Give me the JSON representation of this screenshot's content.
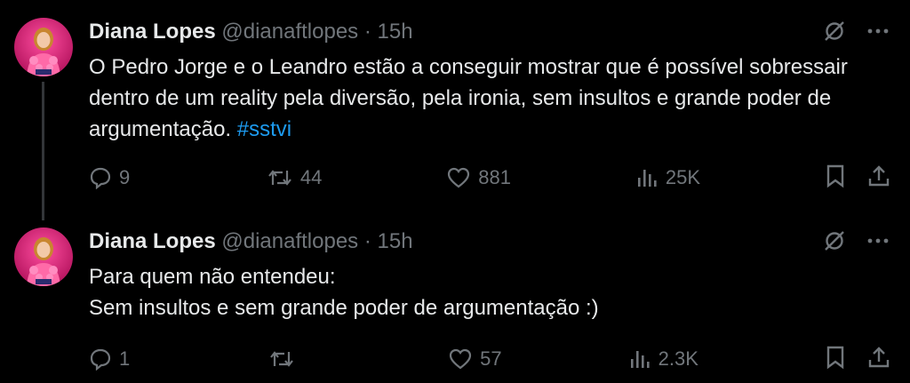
{
  "tweets": [
    {
      "author_name": "Diana Lopes",
      "handle": "@dianaftlopes",
      "separator": "·",
      "time": "15h",
      "text": "O Pedro Jorge e o Leandro estão a conseguir mostrar que é possível sobressair dentro de um reality pela diversão, pela ironia, sem insultos e grande poder de argumentação. ",
      "hashtag": "#sstvi",
      "replies": "9",
      "retweets": "44",
      "likes": "881",
      "views": "25K"
    },
    {
      "author_name": "Diana Lopes",
      "handle": "@dianaftlopes",
      "separator": "·",
      "time": "15h",
      "text_line1": "Para quem não entendeu:",
      "text_line2": "Sem insultos e sem grande poder de argumentação :)",
      "replies": "1",
      "retweets": "",
      "likes": "57",
      "views": "2.3K"
    }
  ],
  "colors": {
    "background": "#000000",
    "text_primary": "#e7e9ea",
    "text_secondary": "#71767b",
    "link": "#1d9bf0",
    "thread_line": "#333639",
    "avatar_accent": "#ff2d8a"
  },
  "icons": {
    "grok": "grok-icon",
    "more": "more-icon",
    "reply": "reply-icon",
    "retweet": "retweet-icon",
    "like": "like-icon",
    "views": "views-icon",
    "bookmark": "bookmark-icon",
    "share": "share-icon"
  }
}
